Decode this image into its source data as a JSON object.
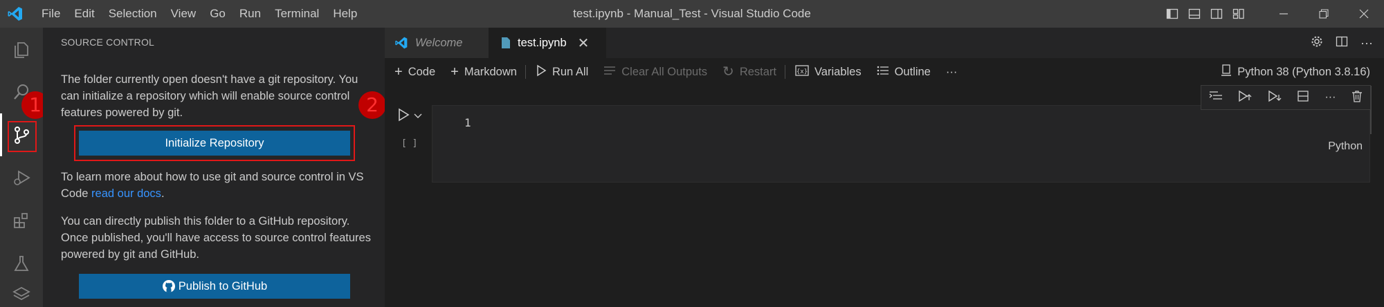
{
  "titlebar": {
    "menu": [
      "File",
      "Edit",
      "Selection",
      "View",
      "Go",
      "Run",
      "Terminal",
      "Help"
    ],
    "title": "test.ipynb - Manual_Test - Visual Studio Code"
  },
  "sidebar": {
    "title": "SOURCE CONTROL",
    "intro": "The folder currently open doesn't have a git repository. You can initialize a repository which will enable source control features powered by git.",
    "init_button": "Initialize Repository",
    "learn_prefix": "To learn more about how to use git and source control in VS Code ",
    "learn_link": "read our docs",
    "learn_suffix": ".",
    "publish_text": "You can directly publish this folder to a GitHub repository. Once published, you'll have access to source control features powered by git and GitHub.",
    "publish_button": "Publish to GitHub"
  },
  "annotations": {
    "badge1": "1",
    "badge2": "2"
  },
  "tabs": [
    {
      "label": "Welcome"
    },
    {
      "label": "test.ipynb"
    }
  ],
  "toolbar": {
    "code": "Code",
    "markdown": "Markdown",
    "run_all": "Run All",
    "clear_outputs": "Clear All Outputs",
    "restart": "Restart",
    "variables": "Variables",
    "outline": "Outline",
    "more": "···",
    "kernel": "Python 38 (Python 3.8.16)"
  },
  "cell": {
    "exec_count": "[ ]",
    "line_number": "1",
    "language": "Python"
  },
  "colors": {
    "accent": "#0e639c",
    "highlight": "#e01818",
    "link": "#3794ff"
  }
}
